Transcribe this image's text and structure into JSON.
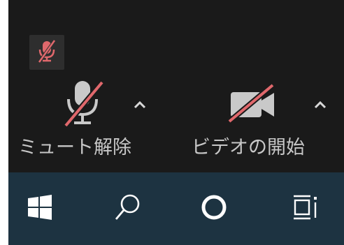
{
  "meeting_controls": {
    "status": {
      "icon": "muted-mic-icon",
      "color": "#e0686c"
    },
    "unmute": {
      "label": "ミュート解除",
      "icon": "mic-off-icon",
      "menu_icon": "chevron-up-icon"
    },
    "start_video": {
      "label": "ビデオの開始",
      "icon": "video-off-icon",
      "menu_icon": "chevron-up-icon"
    },
    "slash_color": "#e0686c"
  },
  "taskbar": {
    "items": [
      {
        "icon": "windows-start-icon"
      },
      {
        "icon": "search-icon"
      },
      {
        "icon": "cortana-icon"
      },
      {
        "icon": "task-view-icon"
      }
    ],
    "background": "#1d3341"
  }
}
